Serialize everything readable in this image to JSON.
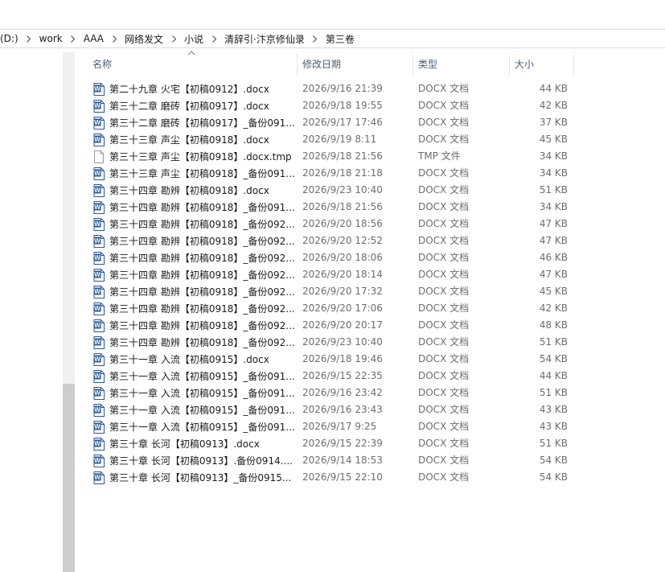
{
  "breadcrumb": [
    "(D:)",
    "work",
    "AAA",
    "网络发文",
    "小说",
    "清辞引·汴京修仙录",
    "第三卷"
  ],
  "columns": {
    "name": "名称",
    "date": "修改日期",
    "type": "类型",
    "size": "大小"
  },
  "files": [
    {
      "name": "第二十九章 火宅【初稿0912】.docx",
      "date": "2026/9/16 21:39",
      "type": "DOCX 文档",
      "size": "44 KB",
      "icon": "word-doc-icon"
    },
    {
      "name": "第三十二章 磨砖【初稿0917】.docx",
      "date": "2026/9/18 19:55",
      "type": "DOCX 文档",
      "size": "42 KB",
      "icon": "word-doc-icon"
    },
    {
      "name": "第三十二章 磨砖【初稿0917】_备份091...",
      "date": "2026/9/17 17:46",
      "type": "DOCX 文档",
      "size": "37 KB",
      "icon": "word-doc-icon"
    },
    {
      "name": "第三十三章 声尘【初稿0918】.docx",
      "date": "2026/9/19 8:11",
      "type": "DOCX 文档",
      "size": "45 KB",
      "icon": "word-doc-icon"
    },
    {
      "name": "第三十三章 声尘【初稿0918】.docx.tmp",
      "date": "2026/9/18 21:56",
      "type": "TMP 文件",
      "size": "34 KB",
      "icon": "blank-file-icon"
    },
    {
      "name": "第三十三章 声尘【初稿0918】_备份091...",
      "date": "2026/9/18 21:18",
      "type": "DOCX 文档",
      "size": "34 KB",
      "icon": "word-doc-icon"
    },
    {
      "name": "第三十四章 勘辨【初稿0918】.docx",
      "date": "2026/9/23 10:40",
      "type": "DOCX 文档",
      "size": "51 KB",
      "icon": "word-doc-icon"
    },
    {
      "name": "第三十四章 勘辨【初稿0918】_备份091...",
      "date": "2026/9/18 21:56",
      "type": "DOCX 文档",
      "size": "34 KB",
      "icon": "word-doc-icon"
    },
    {
      "name": "第三十四章 勘辨【初稿0918】_备份092...",
      "date": "2026/9/20 18:56",
      "type": "DOCX 文档",
      "size": "47 KB",
      "icon": "word-doc-icon"
    },
    {
      "name": "第三十四章 勘辨【初稿0918】_备份092...",
      "date": "2026/9/20 12:52",
      "type": "DOCX 文档",
      "size": "47 KB",
      "icon": "word-doc-icon"
    },
    {
      "name": "第三十四章 勘辨【初稿0918】_备份092...",
      "date": "2026/9/20 18:06",
      "type": "DOCX 文档",
      "size": "46 KB",
      "icon": "word-doc-icon"
    },
    {
      "name": "第三十四章 勘辨【初稿0918】_备份092...",
      "date": "2026/9/20 18:14",
      "type": "DOCX 文档",
      "size": "47 KB",
      "icon": "word-doc-icon"
    },
    {
      "name": "第三十四章 勘辨【初稿0918】_备份092...",
      "date": "2026/9/20 17:32",
      "type": "DOCX 文档",
      "size": "45 KB",
      "icon": "word-doc-icon"
    },
    {
      "name": "第三十四章 勘辨【初稿0918】_备份092...",
      "date": "2026/9/20 17:06",
      "type": "DOCX 文档",
      "size": "42 KB",
      "icon": "word-doc-icon"
    },
    {
      "name": "第三十四章 勘辨【初稿0918】_备份092...",
      "date": "2026/9/20 20:17",
      "type": "DOCX 文档",
      "size": "48 KB",
      "icon": "word-doc-icon"
    },
    {
      "name": "第三十四章 勘辨【初稿0918】_备份092...",
      "date": "2026/9/23 10:40",
      "type": "DOCX 文档",
      "size": "51 KB",
      "icon": "word-doc-icon"
    },
    {
      "name": "第三十一章 入流【初稿0915】.docx",
      "date": "2026/9/18 19:46",
      "type": "DOCX 文档",
      "size": "54 KB",
      "icon": "word-doc-icon"
    },
    {
      "name": "第三十一章 入流【初稿0915】_备份091...",
      "date": "2026/9/15 22:35",
      "type": "DOCX 文档",
      "size": "44 KB",
      "icon": "word-doc-icon"
    },
    {
      "name": "第三十一章 入流【初稿0915】_备份091...",
      "date": "2026/9/16 23:42",
      "type": "DOCX 文档",
      "size": "51 KB",
      "icon": "word-doc-icon"
    },
    {
      "name": "第三十一章 入流【初稿0915】_备份091...",
      "date": "2026/9/16 23:43",
      "type": "DOCX 文档",
      "size": "43 KB",
      "icon": "word-doc-icon"
    },
    {
      "name": "第三十一章 入流【初稿0915】_备份091...",
      "date": "2026/9/17 9:25",
      "type": "DOCX 文档",
      "size": "43 KB",
      "icon": "word-doc-icon"
    },
    {
      "name": "第三十章 长河【初稿0913】.docx",
      "date": "2026/9/15 22:39",
      "type": "DOCX 文档",
      "size": "51 KB",
      "icon": "word-doc-icon"
    },
    {
      "name": "第三十章 长河【初稿0913】.备份0914....",
      "date": "2026/9/14 18:53",
      "type": "DOCX 文档",
      "size": "54 KB",
      "icon": "word-doc-icon"
    },
    {
      "name": "第三十章 长河【初稿0913】_备份0915...",
      "date": "2026/9/15 22:10",
      "type": "DOCX 文档",
      "size": "54 KB",
      "icon": "word-doc-icon"
    }
  ],
  "colors": {
    "word_blue": "#2b579a",
    "header_text": "#4c607a",
    "secondary_text": "#6d6d6d"
  }
}
